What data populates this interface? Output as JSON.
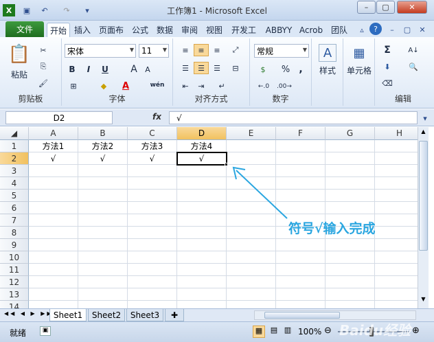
{
  "title": "工作簿1 - Microsoft Excel",
  "file_tab": "文件",
  "tabs": [
    "开始",
    "插入",
    "页面布",
    "公式",
    "数据",
    "审阅",
    "视图",
    "开发工",
    "ABBYY",
    "Acrob",
    "团队"
  ],
  "ribbon": {
    "clipboard": {
      "label": "剪贴板",
      "paste": "粘贴"
    },
    "font": {
      "label": "字体",
      "name": "宋体",
      "size": "11",
      "bold": "B",
      "italic": "I",
      "underline": "U",
      "grow": "A",
      "shrink": "A",
      "color": "A",
      "phonetic": "wén"
    },
    "alignment": {
      "label": "对齐方式"
    },
    "number": {
      "label": "数字",
      "format": "常规",
      "percent": "%",
      "comma": ","
    },
    "styles": {
      "label": "样式"
    },
    "cells": {
      "label": "单元格"
    },
    "editing": {
      "label": "编辑"
    }
  },
  "formula_bar": {
    "name_box": "D2",
    "fx": "fx",
    "content": "√"
  },
  "columns": [
    "A",
    "B",
    "C",
    "D",
    "E",
    "F",
    "G",
    "H"
  ],
  "rows": [
    "1",
    "2",
    "3",
    "4",
    "5",
    "6",
    "7",
    "8",
    "9",
    "10",
    "11",
    "12",
    "13",
    "14"
  ],
  "cells": {
    "A1": "方法1",
    "B1": "方法2",
    "C1": "方法3",
    "D1": "方法4",
    "A2": "√",
    "B2": "√",
    "C2": "√",
    "D2": "√"
  },
  "sheets": [
    "Sheet1",
    "Sheet2",
    "Sheet3"
  ],
  "status": {
    "ready": "就绪",
    "zoom": "100%"
  },
  "annotation": "符号√输入完成",
  "watermark": "Baidu经验",
  "colors": {
    "file_tab": "#2a7d2a",
    "selected_header": "#f5ce7a",
    "annotation": "#2aa6e0"
  }
}
